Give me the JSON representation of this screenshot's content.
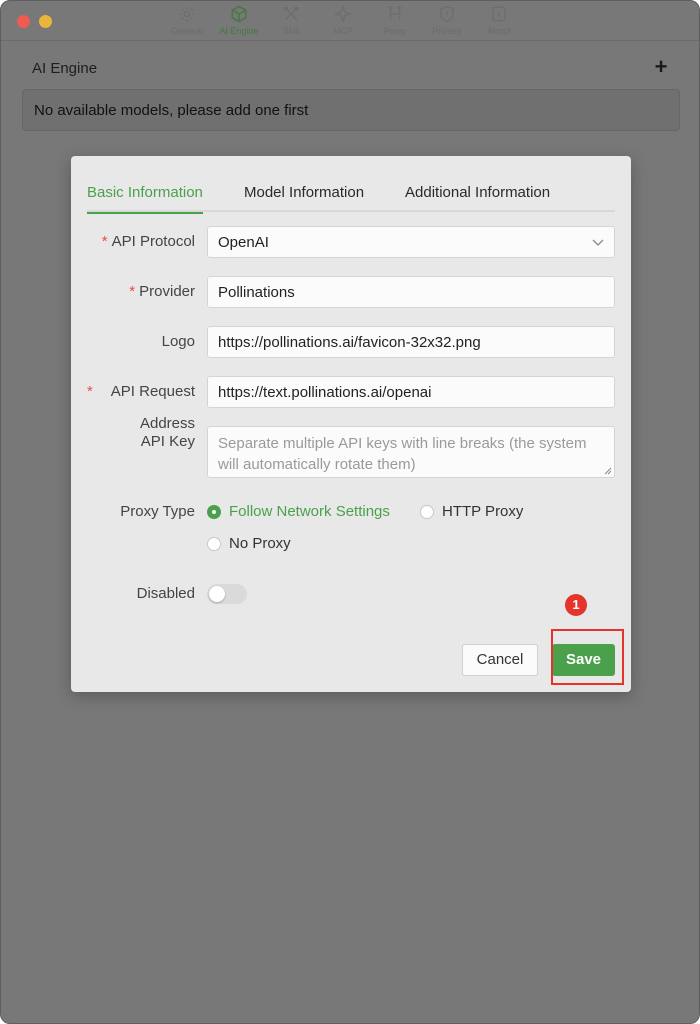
{
  "toolbar": {
    "tabs": [
      {
        "label": "General",
        "icon": "gear-icon"
      },
      {
        "label": "AI Engine",
        "icon": "cube-icon"
      },
      {
        "label": "Skill",
        "icon": "tools-icon"
      },
      {
        "label": "MCP",
        "icon": "sparkle-icon"
      },
      {
        "label": "Proxy",
        "icon": "network-icon"
      },
      {
        "label": "Privacy",
        "icon": "shield-icon"
      },
      {
        "label": "About",
        "icon": "info-icon"
      }
    ],
    "active_tab": "AI Engine"
  },
  "main": {
    "section_title": "AI Engine",
    "add_icon": "+",
    "empty_message": "No available models, please add one first"
  },
  "modal": {
    "tabs": {
      "basic": "Basic Information",
      "model": "Model Information",
      "additional": "Additional Information"
    },
    "required_mark": "*",
    "fields": {
      "api_protocol": {
        "label": "API Protocol",
        "value": "OpenAI"
      },
      "provider": {
        "label": "Provider",
        "value": "Pollinations"
      },
      "logo": {
        "label": "Logo",
        "value": "https://pollinations.ai/favicon-32x32.png"
      },
      "api_request": {
        "label": "API Request",
        "label_line2": "Address",
        "value": "https://text.pollinations.ai/openai"
      },
      "api_key": {
        "label": "API Key",
        "placeholder": "Separate multiple API keys with line breaks (the system will automatically rotate them)"
      },
      "proxy_type": {
        "label": "Proxy Type",
        "options": {
          "follow": "Follow Network Settings",
          "http": "HTTP Proxy",
          "none": "No Proxy"
        },
        "selected": "Follow Network Settings"
      },
      "disabled": {
        "label": "Disabled",
        "value": false
      }
    },
    "buttons": {
      "cancel": "Cancel",
      "save": "Save"
    }
  },
  "annotation": {
    "step": "1"
  },
  "colors": {
    "accent": "#4ba14b",
    "required": "#e84c4c",
    "annotation": "#e5342c"
  }
}
